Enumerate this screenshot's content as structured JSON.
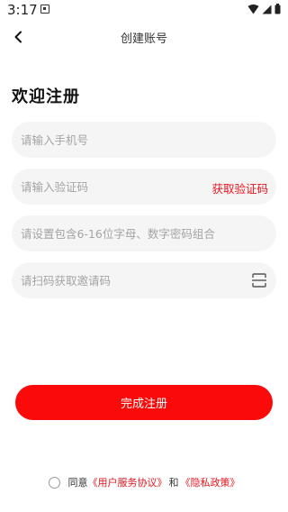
{
  "status_bar": {
    "time": "3:17"
  },
  "nav": {
    "title": "创建账号"
  },
  "page": {
    "title": "欢迎注册"
  },
  "form": {
    "phone_placeholder": "请输入手机号",
    "code_placeholder": "请输入验证码",
    "get_code_label": "获取验证码",
    "password_placeholder": "请设置包含6-16位字母、数字密码组合",
    "invite_placeholder": "请扫码获取邀请码"
  },
  "submit": {
    "label": "完成注册"
  },
  "agreement": {
    "prefix": "同意",
    "user_agreement": "《用户服务协议》",
    "and": "和",
    "privacy_policy": "《隐私政策》"
  },
  "colors": {
    "accent": "#fb0a0a",
    "link": "#e8141c",
    "field_bg": "#f5f5f5"
  }
}
